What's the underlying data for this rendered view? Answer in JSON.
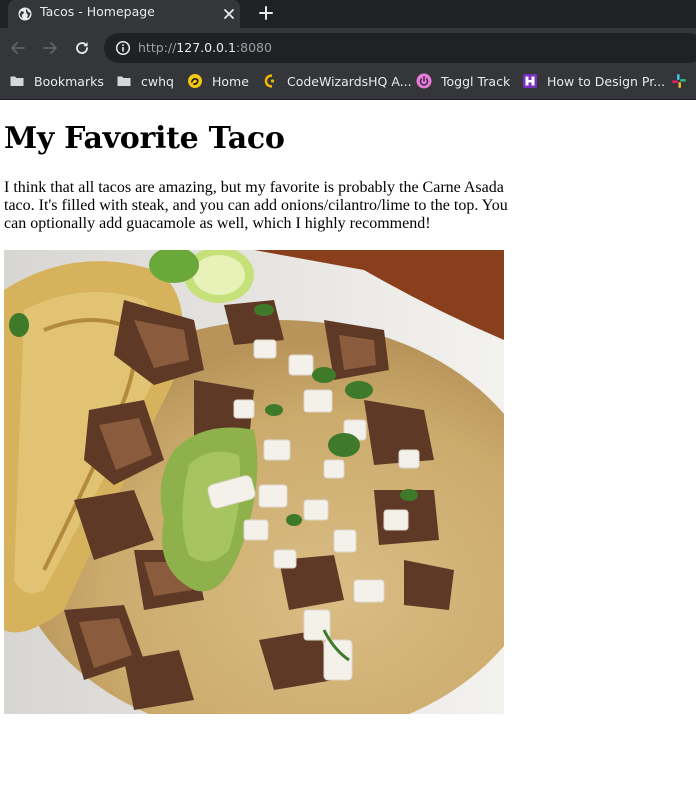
{
  "browser": {
    "tab": {
      "title": "Tacos - Homepage"
    },
    "address_bar": {
      "scheme": "http://",
      "host": "127.0.0.1",
      "port": ":8080"
    },
    "bookmarks": [
      {
        "label": "Bookmarks",
        "icon": "folder-icon"
      },
      {
        "label": "cwhq",
        "icon": "folder-icon"
      },
      {
        "label": "Home",
        "icon": "home-favicon"
      },
      {
        "label": "CodeWizardsHQ A...",
        "icon": "codewizards-favicon"
      },
      {
        "label": "Toggl Track",
        "icon": "toggl-favicon"
      },
      {
        "label": "How to Design Pr...",
        "icon": "design-favicon"
      }
    ]
  },
  "page": {
    "heading": "My Favorite Taco",
    "paragraph": "I think that all tacos are amazing, but my favorite is probably the Carne Asada taco. It's filled with steak, and you can add onions/cilantro/lime to the top. You can optionally add guacamole as well, which I highly recommend!"
  },
  "colors": {
    "chrome_dark": "#202124",
    "chrome": "#35363a",
    "chrome_text": "#e8eaed",
    "toggl": "#e57cd8",
    "design": "#7b2fbe"
  }
}
